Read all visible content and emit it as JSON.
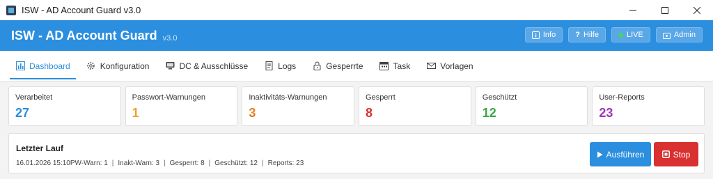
{
  "window": {
    "title": "ISW - AD Account Guard v3.0"
  },
  "header": {
    "brand": "ISW - AD Account Guard",
    "version": "v3.0",
    "buttons": [
      {
        "label": "Info",
        "icon": "info-icon"
      },
      {
        "label": "Hilfe",
        "icon": "help-icon"
      },
      {
        "label": "LIVE",
        "icon": "live-dot-icon"
      },
      {
        "label": "Admin",
        "icon": "admin-icon"
      }
    ],
    "colors": {
      "header_bg": "#2b8ede",
      "live_dot": "#46d16a"
    }
  },
  "tabs": [
    {
      "label": "Dashboard",
      "icon": "chart-icon",
      "active": true
    },
    {
      "label": "Konfiguration",
      "icon": "gear-icon"
    },
    {
      "label": "DC & Ausschlüsse",
      "icon": "server-icon"
    },
    {
      "label": "Logs",
      "icon": "document-icon"
    },
    {
      "label": "Gesperrte",
      "icon": "lock-icon"
    },
    {
      "label": "Task",
      "icon": "calendar-icon"
    },
    {
      "label": "Vorlagen",
      "icon": "mail-icon"
    }
  ],
  "stats": [
    {
      "label": "Verarbeitet",
      "value": "27",
      "color": "#2b8ede"
    },
    {
      "label": "Passwort-Warnungen",
      "value": "1",
      "color": "#f0a030"
    },
    {
      "label": "Inaktivitäts-Warnungen",
      "value": "3",
      "color": "#e67e22"
    },
    {
      "label": "Gesperrt",
      "value": "8",
      "color": "#d93030"
    },
    {
      "label": "Geschützt",
      "value": "12",
      "color": "#3aa845"
    },
    {
      "label": "User-Reports",
      "value": "23",
      "color": "#9b35b5"
    }
  ],
  "last_run": {
    "title": "Letzter Lauf",
    "timestamp": "16.01.2026 15:10",
    "items": [
      "PW-Warn: 1",
      "Inakt-Warn: 3",
      "Gesperrt: 8",
      "Geschützt: 12",
      "Reports: 23"
    ],
    "execute_label": "Ausführen",
    "stop_label": "Stop",
    "colors": {
      "execute": "#2b8ede",
      "stop": "#d93030"
    }
  }
}
